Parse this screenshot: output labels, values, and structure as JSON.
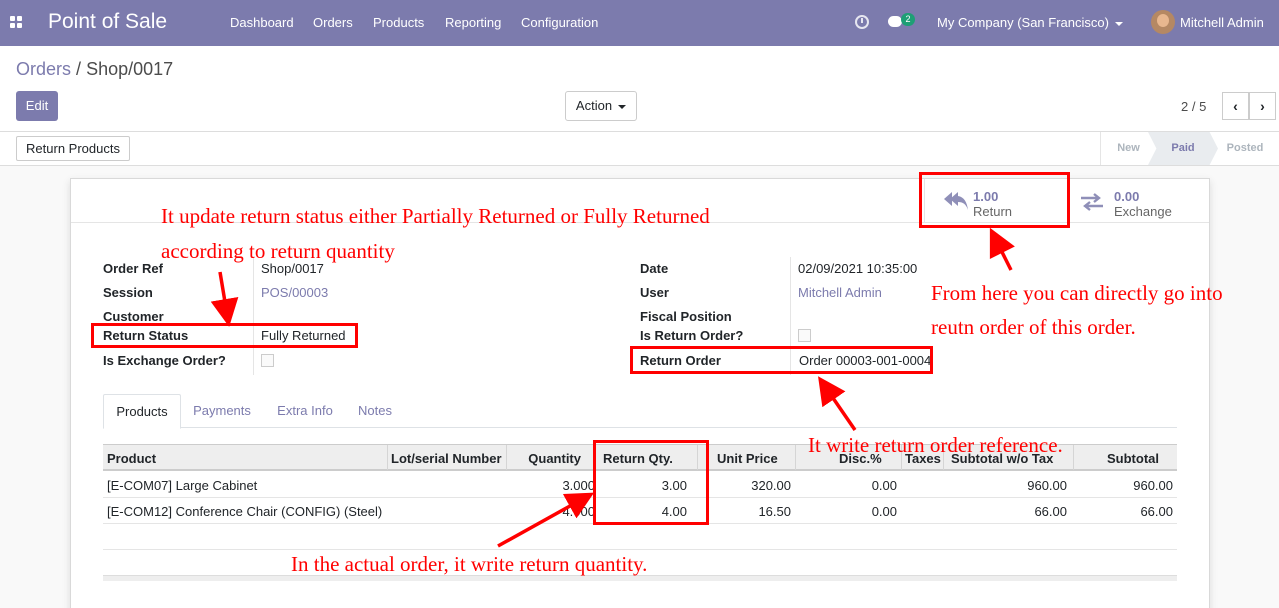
{
  "navbar": {
    "app_title": "Point of Sale",
    "menu": [
      "Dashboard",
      "Orders",
      "Products",
      "Reporting",
      "Configuration"
    ],
    "chat_count": "2",
    "company": "My Company (San Francisco)",
    "user": "Mitchell Admin"
  },
  "breadcrumb": {
    "parent": "Orders",
    "separator": "/",
    "current": "Shop/0017"
  },
  "toolbar": {
    "edit_label": "Edit",
    "action_label": "Action"
  },
  "pager": {
    "value": "2 / 5",
    "prev": "‹",
    "next": "›"
  },
  "statusbar": {
    "return_products_label": "Return Products",
    "states": [
      "New",
      "Paid",
      "Posted"
    ],
    "active_state": "Paid"
  },
  "smart_buttons": {
    "return": {
      "value": "1.00",
      "label": "Return"
    },
    "exchange": {
      "value": "0.00",
      "label": "Exchange"
    }
  },
  "form": {
    "order_ref": {
      "label": "Order Ref",
      "value": "Shop/0017"
    },
    "session": {
      "label": "Session",
      "value": "POS/00003"
    },
    "customer": {
      "label": "Customer",
      "value": ""
    },
    "return_status": {
      "label": "Return Status",
      "value": "Fully Returned"
    },
    "is_exchange": {
      "label": "Is Exchange Order?"
    },
    "date": {
      "label": "Date",
      "value": "02/09/2021 10:35:00"
    },
    "user": {
      "label": "User",
      "value": "Mitchell Admin"
    },
    "fiscal_position": {
      "label": "Fiscal Position",
      "value": ""
    },
    "is_return": {
      "label": "Is Return Order?"
    },
    "return_order": {
      "label": "Return Order",
      "value": "Order 00003-001-0004"
    }
  },
  "tabs": [
    "Products",
    "Payments",
    "Extra Info",
    "Notes"
  ],
  "table": {
    "headers": [
      "Product",
      "Lot/serial Number",
      "Quantity",
      "Return Qty.",
      "Unit Price",
      "Disc.%",
      "Taxes",
      "Subtotal w/o Tax",
      "Subtotal"
    ],
    "rows": [
      [
        "[E-COM07] Large Cabinet",
        "",
        "3.000",
        "3.00",
        "320.00",
        "0.00",
        "",
        "960.00",
        "960.00"
      ],
      [
        "[E-COM12] Conference Chair (CONFIG) (Steel)",
        "",
        "4.000",
        "4.00",
        "16.50",
        "0.00",
        "",
        "66.00",
        "66.00"
      ]
    ]
  },
  "annotations": {
    "status_line1": "It update return status either Partially Returned or Fully Returned",
    "status_line2": "according to return quantity",
    "smart_line1": "From here you can directly go into",
    "smart_line2": "reutn order of this order.",
    "ref_note": "It write return order reference.",
    "qty_note": "In the actual order, it write return quantity."
  },
  "colors": {
    "brand": "#7c7bad",
    "annotation": "#ff0000"
  }
}
